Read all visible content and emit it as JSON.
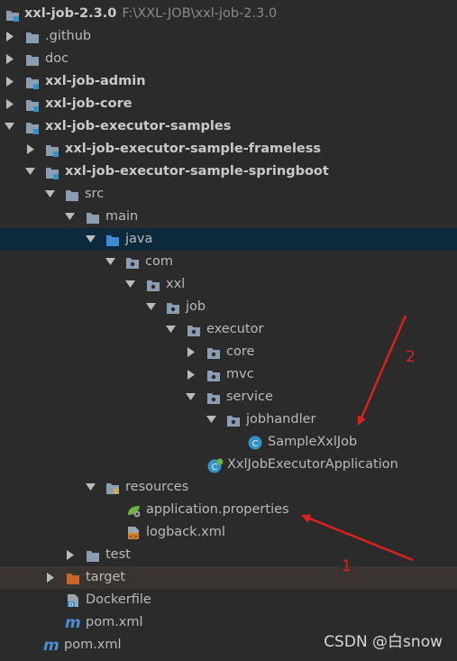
{
  "project": {
    "name": "xxl-job-2.3.0",
    "path": "F:\\XXL-JOB\\xxl-job-2.3.0"
  },
  "tree": [
    {
      "label": ".github",
      "icon": "folder-icon"
    },
    {
      "label": "doc",
      "icon": "folder-icon"
    },
    {
      "label": "xxl-job-admin",
      "icon": "module-folder-icon"
    },
    {
      "label": "xxl-job-core",
      "icon": "module-folder-icon"
    },
    {
      "label": "xxl-job-executor-samples",
      "icon": "module-folder-icon"
    },
    {
      "label": "xxl-job-executor-sample-frameless",
      "icon": "module-folder-icon"
    },
    {
      "label": "xxl-job-executor-sample-springboot",
      "icon": "module-folder-icon"
    },
    {
      "label": "src",
      "icon": "folder-icon"
    },
    {
      "label": "main",
      "icon": "folder-icon"
    },
    {
      "label": "java",
      "icon": "source-root-icon"
    },
    {
      "label": "com",
      "icon": "package-icon"
    },
    {
      "label": "xxl",
      "icon": "package-icon"
    },
    {
      "label": "job",
      "icon": "package-icon"
    },
    {
      "label": "executor",
      "icon": "package-icon"
    },
    {
      "label": "core",
      "icon": "package-icon"
    },
    {
      "label": "mvc",
      "icon": "package-icon"
    },
    {
      "label": "service",
      "icon": "package-icon"
    },
    {
      "label": "jobhandler",
      "icon": "package-icon"
    },
    {
      "label": "SampleXxlJob",
      "icon": "java-class-icon"
    },
    {
      "label": "XxlJobExecutorApplication",
      "icon": "spring-boot-class-icon"
    },
    {
      "label": "resources",
      "icon": "resources-folder-icon"
    },
    {
      "label": "application.properties",
      "icon": "spring-properties-icon"
    },
    {
      "label": "logback.xml",
      "icon": "xml-file-icon"
    },
    {
      "label": "test",
      "icon": "folder-icon"
    },
    {
      "label": "target",
      "icon": "excluded-folder-icon"
    },
    {
      "label": "Dockerfile",
      "icon": "docker-file-icon"
    },
    {
      "label": "pom.xml",
      "icon": "maven-pom-icon"
    },
    {
      "label": "pom.xml",
      "icon": "maven-pom-icon"
    }
  ],
  "annotations": {
    "label_1": "1",
    "label_2": "2",
    "color": "#e0201c"
  },
  "watermark": "CSDN @白snow"
}
